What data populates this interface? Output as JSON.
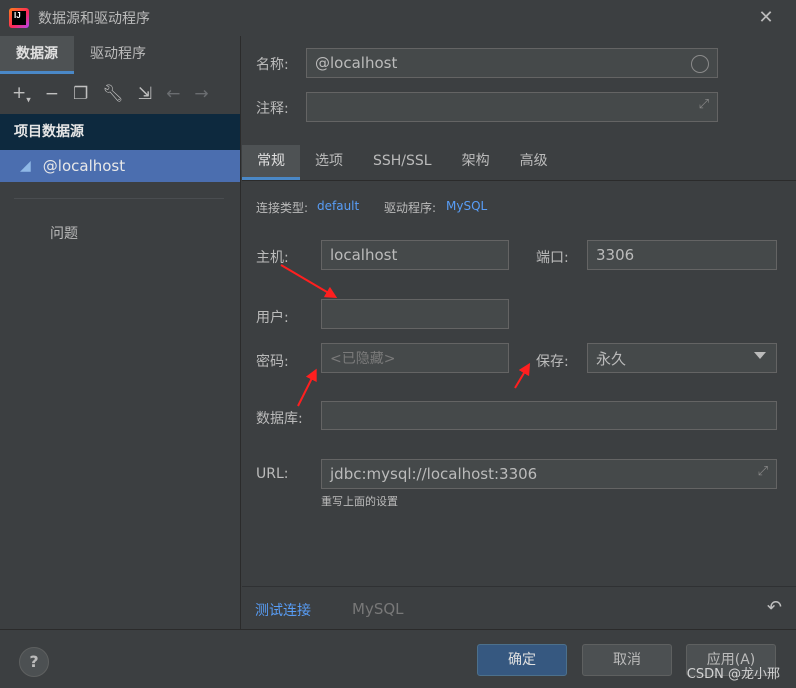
{
  "window": {
    "title": "数据源和驱动程序",
    "icon": "intellij-app-icon"
  },
  "left": {
    "tabs": [
      {
        "label": "数据源"
      },
      {
        "label": "驱动程序"
      }
    ],
    "toolbar_icons": [
      "plus-icon",
      "minus-icon",
      "duplicate-icon",
      "wrench-icon",
      "import-icon",
      "back-arrow-icon",
      "forward-arrow-icon"
    ],
    "section_header": "项目数据源",
    "selected_item": "@localhost",
    "problems_label": "问题"
  },
  "form": {
    "name_label": "名称:",
    "name_value": "@localhost",
    "comment_label": "注释:",
    "comment_value": "",
    "tabs": [
      {
        "label": "常规"
      },
      {
        "label": "选项"
      },
      {
        "label": "SSH/SSL"
      },
      {
        "label": "架构"
      },
      {
        "label": "高级"
      }
    ],
    "conn_type_label": "连接类型:",
    "conn_type_value": "default",
    "driver_label": "驱动程序:",
    "driver_value": "MySQL",
    "host_label": "主机:",
    "host_value": "localhost",
    "port_label": "端口:",
    "port_value": "3306",
    "user_label": "用户:",
    "user_value": "",
    "password_label": "密码:",
    "password_placeholder": "<已隐藏>",
    "save_label": "保存:",
    "save_value": "永久",
    "database_label": "数据库:",
    "database_value": "",
    "url_label": "URL:",
    "url_value": "jdbc:mysql://localhost:3306",
    "url_hint": "重写上面的设置",
    "test_connection": "测试连接",
    "driver_name": "MySQL"
  },
  "footer": {
    "help": "?",
    "ok": "确定",
    "cancel": "取消",
    "apply": "应用(A)",
    "watermark": "CSDN @龙小邢"
  },
  "colors": {
    "accent": "#4a88c7",
    "link": "#589df6",
    "annotation_arrow": "#ff1f1f",
    "selection": "#4b6eaf"
  }
}
